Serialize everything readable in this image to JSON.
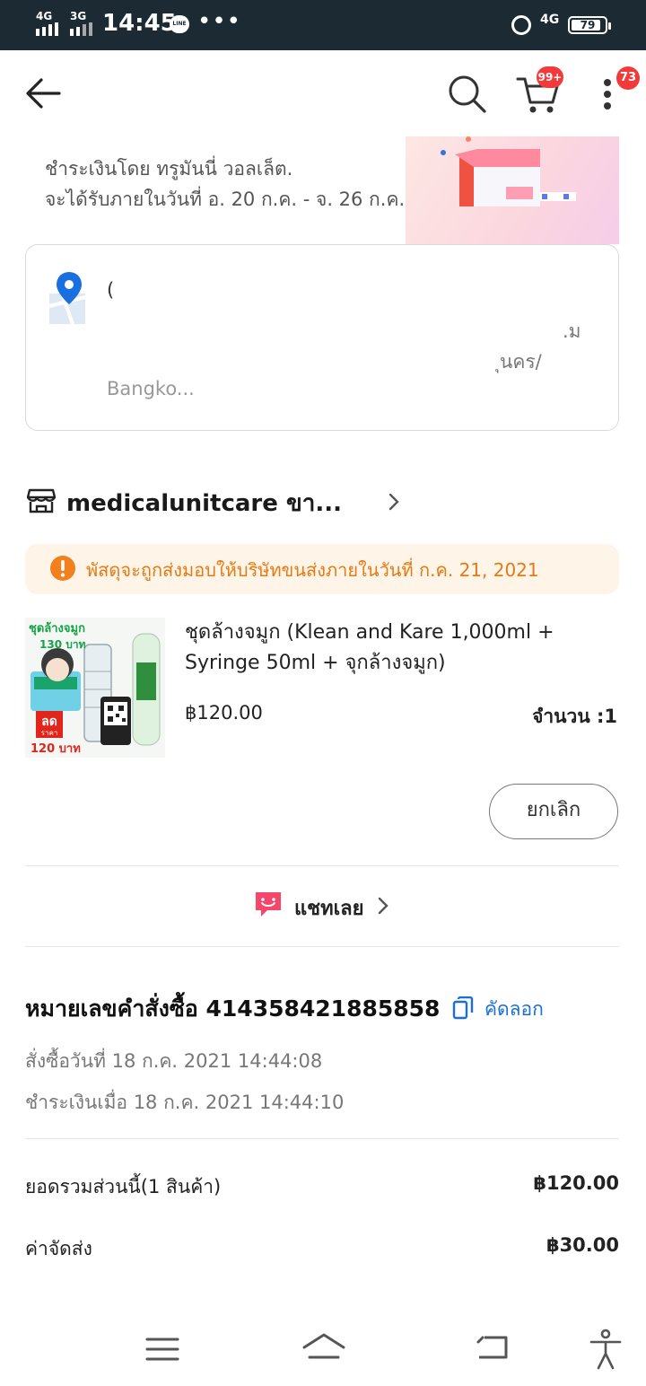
{
  "status_bar": {
    "signal_1": "4G",
    "signal_2": "3G",
    "time": "14:45",
    "line_icon": "LINE",
    "more": "•••",
    "network": "4G",
    "battery": "79"
  },
  "header": {
    "cart_badge": "99+",
    "more_badge": "73"
  },
  "delivery": {
    "payment_line": "ชำระเงินโดย ทรูมันนี่ วอลเล็ต.",
    "eta_line": "จะได้รับภายในวันที่ อ. 20 ก.ค. - จ. 26 ก.ค."
  },
  "address": {
    "line_1": "(",
    "line_2": ".ม",
    "line_3": "ุนคร/",
    "line_4": "Bangko..."
  },
  "shop": {
    "name": "medicalunitcare ขา..."
  },
  "notice": {
    "text": "พัสดุจะถูกส่งมอบให้บริษัทขนส่งภายในวันที่ ก.ค. 21, 2021"
  },
  "product": {
    "title": "ชุดล้างจมูก (Klean and Kare 1,000ml + Syringe 50ml + จุกล้างจมูก)",
    "price": "฿120.00",
    "quantity": "จำนวน :1",
    "image_text": {
      "top": "ชุดล้างจมูก",
      "old_price": "130 บาท",
      "sale": "ลด",
      "sale_sub": "ราคา",
      "new_price": "120 บาท"
    }
  },
  "actions": {
    "cancel": "ยกเลิก",
    "chat": "แชทเลย"
  },
  "order": {
    "number_line": "หมายเลขคำสั่งซื้อ 414358421885858",
    "copy": "คัดลอก",
    "ordered_at": "สั่งซื้อวันที่ 18 ก.ค. 2021  14:44:08",
    "paid_at": "ชำระเงินเมื่อ 18 ก.ค. 2021  14:44:10"
  },
  "summary": {
    "subtotal_label": "ยอดรวมส่วนนี้(1 สินค้า)",
    "subtotal_value": "฿120.00",
    "shipping_label": "ค่าจัดส่ง",
    "shipping_value": "฿30.00"
  },
  "colors": {
    "status_bar": "#1b2a33",
    "badge": "#f23a3a",
    "notice_bg": "#fff4e8",
    "notice_text": "#e67a13",
    "link": "#1a6fe0",
    "chat_icon": "#f5476b"
  }
}
